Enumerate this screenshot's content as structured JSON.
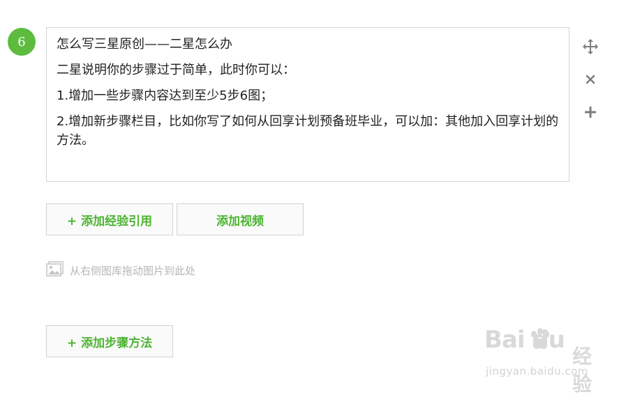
{
  "step": {
    "number": "6"
  },
  "editor": {
    "paragraphs": [
      "怎么写三星原创——二星怎么办",
      "二星说明你的步骤过于简单，此时你可以：",
      "1.增加一些步骤内容达到至少5步6图；",
      "2.增加新步骤栏目，比如你写了如何从回享计划预备班毕业，可以加：其他加入回享计划的方法。"
    ]
  },
  "side_tools": {
    "icons": [
      "move-icon",
      "close-icon",
      "plus-icon"
    ]
  },
  "buttons": {
    "add_experience": "+ 添加经验引用",
    "add_video": "添加视频",
    "add_step": "+ 添加步骤方法"
  },
  "drop_hint": {
    "text": "从右侧图库拖动图片到此处"
  },
  "watermark": {
    "logo": "Bai du",
    "tail": "经验",
    "url": "jingyan.baidu.com"
  },
  "colors": {
    "accent": "#4db431",
    "badge": "#5dbb3d",
    "border": "#d2d2d2"
  }
}
